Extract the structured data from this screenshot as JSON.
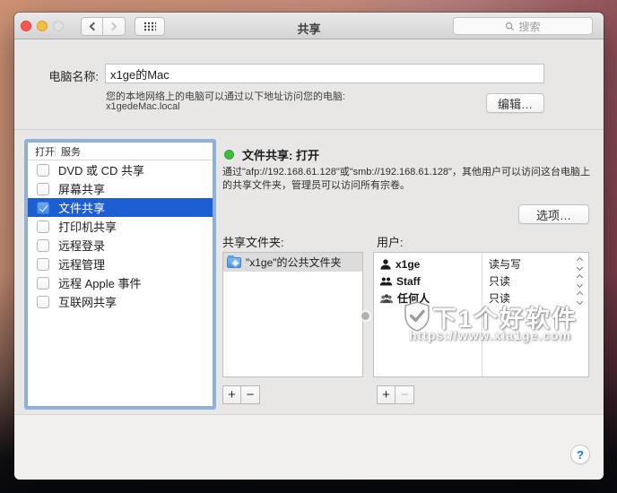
{
  "window": {
    "title": "共享"
  },
  "toolbar": {
    "search_placeholder": "搜索"
  },
  "computer_name": {
    "label": "电脑名称:",
    "value": "x1ge的Mac",
    "description": "您的本地网络上的电脑可以通过以下地址访问您的电脑:",
    "hostname": "x1gedeMac.local",
    "edit_button": "编辑…"
  },
  "services": {
    "columns": {
      "on": "打开",
      "service": "服务"
    },
    "items": [
      {
        "label": "DVD 或 CD 共享",
        "checked": false,
        "selected": false
      },
      {
        "label": "屏幕共享",
        "checked": false,
        "selected": false
      },
      {
        "label": "文件共享",
        "checked": true,
        "selected": true
      },
      {
        "label": "打印机共享",
        "checked": false,
        "selected": false
      },
      {
        "label": "远程登录",
        "checked": false,
        "selected": false
      },
      {
        "label": "远程管理",
        "checked": false,
        "selected": false
      },
      {
        "label": "远程 Apple 事件",
        "checked": false,
        "selected": false
      },
      {
        "label": "互联网共享",
        "checked": false,
        "selected": false
      }
    ]
  },
  "detail": {
    "status_title": "文件共享: 打开",
    "status_color": "#3ebc3e",
    "description": "通过\"afp://192.168.61.128\"或\"smb://192.168.61.128\"，其他用户可以访问这台电脑上的共享文件夹，管理员可以访问所有宗卷。",
    "options_button": "选项…"
  },
  "shared_folders": {
    "label": "共享文件夹:",
    "items": [
      {
        "name": "\"x1ge\"的公共文件夹"
      }
    ]
  },
  "users": {
    "label": "用户:",
    "items": [
      {
        "name": "x1ge",
        "permission": "读与写",
        "icon": "user-icon"
      },
      {
        "name": "Staff",
        "permission": "只读",
        "icon": "users-two-icon"
      },
      {
        "name": "任何人",
        "permission": "只读",
        "icon": "everyone-icon"
      }
    ]
  },
  "controls": {
    "add": "+",
    "remove": "−"
  },
  "help": {
    "label": "?"
  },
  "watermark": {
    "title": "下1个好软件",
    "url": "https://www.xia1ge.com"
  },
  "colors": {
    "selection_blue": "#1d5fd3",
    "status_green": "#3ebc3e",
    "folder_selection_gray": "#dcdcdc"
  }
}
